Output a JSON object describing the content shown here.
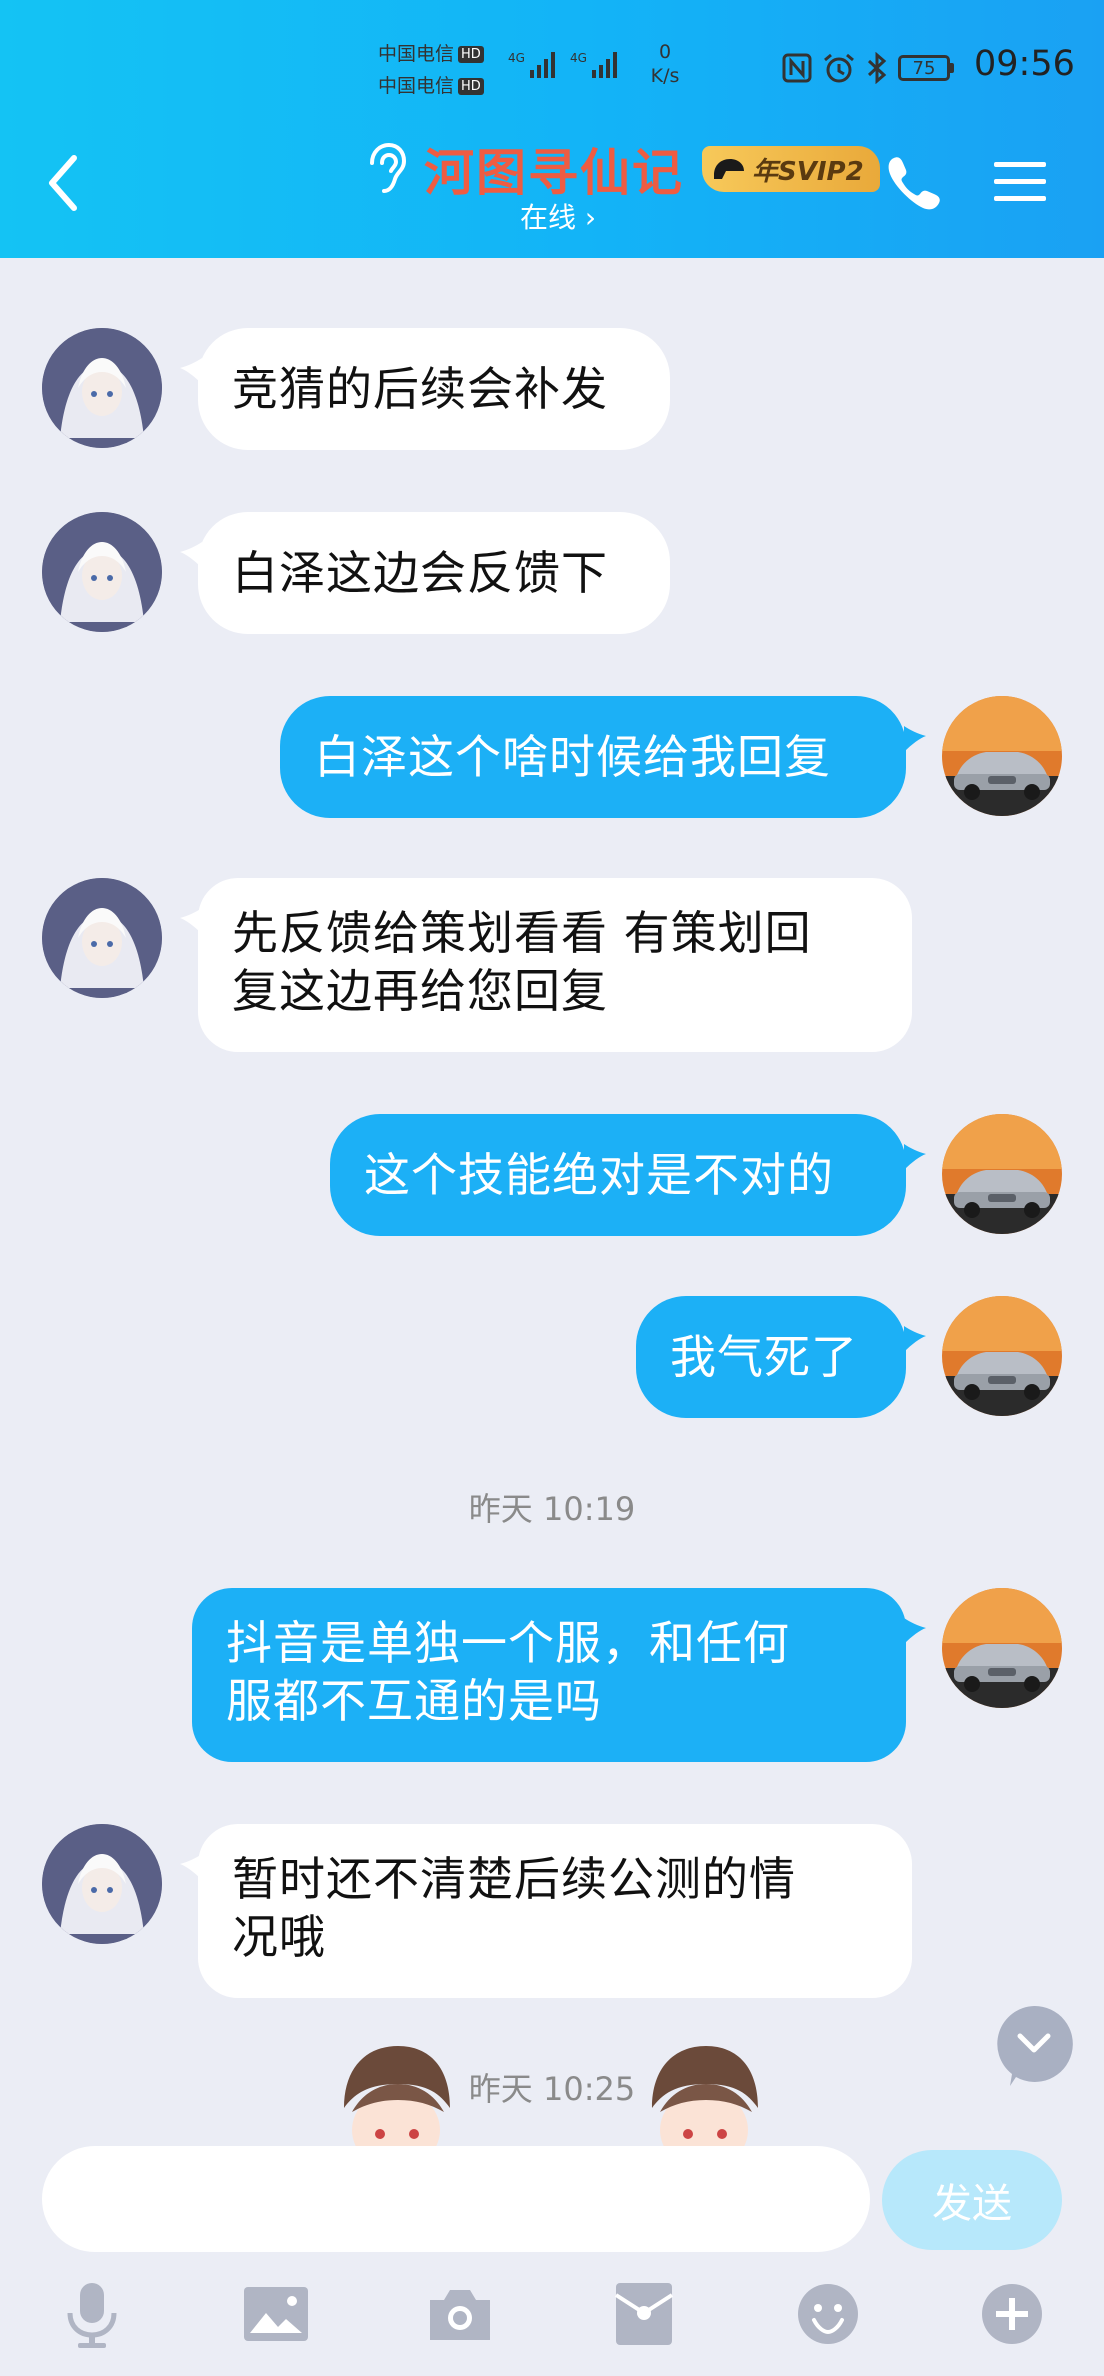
{
  "status_bar": {
    "carrier_1": "中国电信",
    "carrier_2": "中国电信",
    "hd": "HD",
    "net_speed_value": "0",
    "net_speed_unit": "K/s",
    "battery": "75",
    "time": "09:56"
  },
  "header": {
    "contact_name": "河图寻仙记",
    "badge": "年SVIP2",
    "status": "在线 ›"
  },
  "messages": [
    {
      "side": "in",
      "text": "竞猜的后续会补发"
    },
    {
      "side": "in",
      "text": "白泽这边会反馈下"
    },
    {
      "side": "out",
      "text": "白泽这个啥时候给我回复"
    },
    {
      "side": "in",
      "lines": [
        "先反馈给策划看看 有策划回",
        "复这边再给您回复"
      ]
    },
    {
      "side": "out",
      "text": "这个技能绝对是不对的"
    },
    {
      "side": "out",
      "text": "我气死了"
    },
    {
      "timestamp": "昨天 10:19"
    },
    {
      "side": "out",
      "lines": [
        "抖音是单独一个服，和任何",
        "服都不互通的是吗"
      ]
    },
    {
      "side": "in",
      "lines": [
        "暂时还不清楚后续公测的情",
        "况哦"
      ]
    },
    {
      "timestamp": "昨天 10:25"
    }
  ],
  "input": {
    "placeholder": "",
    "send_label": "发送"
  },
  "toolbar": [
    "microphone-icon",
    "image-icon",
    "camera-icon",
    "red-packet-icon",
    "emoji-icon",
    "plus-icon"
  ]
}
